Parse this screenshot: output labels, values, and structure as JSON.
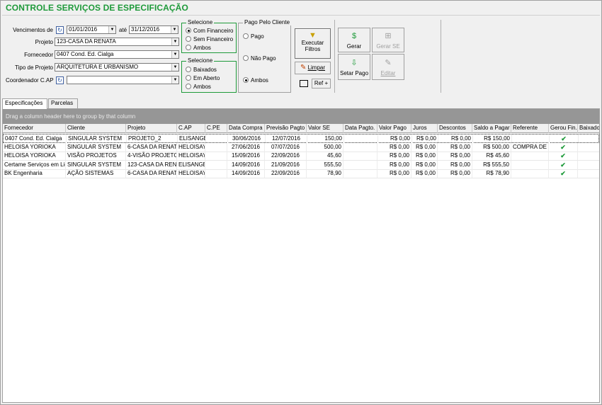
{
  "title": "CONTROLE SERVIÇOS DE ESPECIFICAÇÃO",
  "filters": {
    "vencimentos_label": "Vencimentos de",
    "date_from": "01/01/2016",
    "ate_label": "até",
    "date_to": "31/12/2016",
    "projeto_label": "Projeto",
    "projeto_value": "123-CASA DA RENATA",
    "fornecedor_label": "Fornecedor",
    "fornecedor_value": "0407 Cond. Ed. Cialga",
    "tipo_label": "Tipo de Projeto",
    "tipo_value": "ARQUITETURA E URBANISMO",
    "coordenador_label": "Coordenador C.AP",
    "coordenador_value": ""
  },
  "selecione1": {
    "title": "Selecione",
    "options": [
      "Com Financeiro",
      "Sem Financeiro",
      "Ambos"
    ],
    "selected": 0
  },
  "selecione2": {
    "title": "Selecione",
    "options": [
      "Baixados",
      "Em Aberto",
      "Ambos"
    ]
  },
  "pago_cliente": {
    "title": "Pago Pelo Cliente",
    "options": [
      "Pago",
      "Não Pago",
      "Ambos"
    ],
    "selected": 2
  },
  "buttons": {
    "executar": "Executar Filtros",
    "limpar": "Limpar",
    "ref": "Ref +",
    "gerar": "Gerar",
    "gerar_se": "Gerar SE",
    "setar_pago": "Setar Pago",
    "editar": "Editar"
  },
  "tabs": [
    "Especificações",
    "Parcelas"
  ],
  "grid": {
    "group_hint": "Drag a column header here to group by that column",
    "columns": [
      "Fornecedor",
      "Cliente",
      "Projeto",
      "C.AP",
      "C.PE",
      "Data Compra",
      "Previsão Pagto",
      "Valor SE",
      "Data Pagto.",
      "Valor Pago",
      "Juros",
      "Descontos",
      "Saldo a Pagar",
      "Referente",
      "Gerou Fin.",
      "Baixado"
    ],
    "rows": [
      [
        "0407 Cond. Ed. Cialga",
        "SINGULAR SYSTEM",
        "PROJETO_2",
        "ELISANGE",
        "",
        "30/06/2016",
        "12/07/2016",
        "150,00",
        "",
        "R$ 0,00",
        "R$ 0,00",
        "R$ 0,00",
        "R$ 150,00",
        "",
        "✔",
        ""
      ],
      [
        "HELOISA YORIOKA",
        "SINGULAR SYSTEM",
        "6-CASA DA RENAT",
        "HELOISAY",
        "",
        "27/06/2016",
        "07/07/2016",
        "500,00",
        "",
        "R$ 0,00",
        "R$ 0,00",
        "R$ 0,00",
        "R$ 500,00",
        "COMPRA DE",
        "✔",
        ""
      ],
      [
        "HELOISA YORIOKA",
        "VISÃO PROJETOS",
        "4-VISÃO PROJETC",
        "HELOISAY",
        "",
        "15/09/2016",
        "22/09/2016",
        "45,60",
        "",
        "R$ 0,00",
        "R$ 0,00",
        "R$ 0,00",
        "R$ 45,60",
        "",
        "✔",
        ""
      ],
      [
        "Certame Serviços em Lic",
        "SINGULAR SYSTEM",
        "123-CASA DA REN",
        "ELISANGE",
        "",
        "14/09/2016",
        "21/09/2016",
        "555,50",
        "",
        "R$ 0,00",
        "R$ 0,00",
        "R$ 0,00",
        "R$ 555,50",
        "",
        "✔",
        ""
      ],
      [
        "BK Engenharia",
        "AÇÃO SISTEMAS",
        "6-CASA DA RENAT",
        "HELOISAY",
        "",
        "14/09/2016",
        "22/09/2016",
        "78,90",
        "",
        "R$ 0,00",
        "R$ 0,00",
        "R$ 0,00",
        "R$ 78,90",
        "",
        "✔",
        ""
      ]
    ]
  }
}
